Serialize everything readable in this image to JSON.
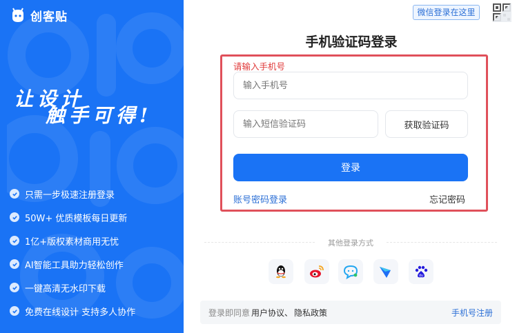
{
  "brand": {
    "name": "创客贴"
  },
  "slogan": {
    "line1": "让设计",
    "line2": "触手可得!"
  },
  "features": [
    "只需一步极速注册登录",
    "50W+ 优质模板每日更新",
    "1亿+版权素材商用无忧",
    "AI智能工具助力轻松创作",
    "一键高清无水印下载",
    "免费在线设计 支持多人协作"
  ],
  "wechat_tip": "微信登录在这里",
  "qr_icon": "qr-code-icon",
  "login": {
    "title": "手机验证码登录",
    "hint": "请输入手机号",
    "phone_placeholder": "输入手机号",
    "sms_placeholder": "输入短信验证码",
    "get_code_label": "获取验证码",
    "submit_label": "登录",
    "password_login_link": "账号密码登录",
    "forgot_password_link": "忘记密码"
  },
  "other_login": {
    "label": "其他登录方式",
    "icons": [
      "qq-icon",
      "weibo-icon",
      "chat-icon",
      "feishu-icon",
      "baidu-icon"
    ]
  },
  "agreement": {
    "prefix": "登录即同意",
    "user_agreement": "用户协议、",
    "privacy_policy": "隐私政策",
    "phone_register": "手机号注册"
  },
  "colors": {
    "accent": "#1a73f5",
    "highlight": "#e0505a",
    "error_text": "#e03a3a"
  }
}
